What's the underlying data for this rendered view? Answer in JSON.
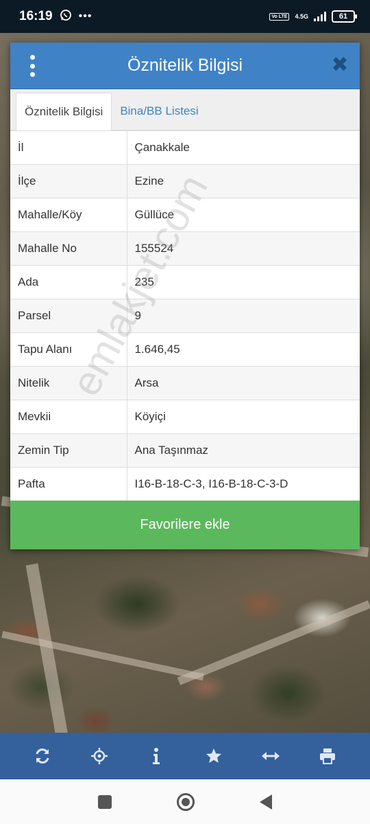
{
  "status_bar": {
    "time": "16:19",
    "network": "4.5G",
    "volte": "Vo LTE",
    "battery": "61"
  },
  "dialog": {
    "title": "Öznitelik Bilgisi",
    "close_symbol": "✖",
    "tabs": [
      {
        "label": "Öznitelik Bilgisi",
        "active": true
      },
      {
        "label": "Bina/BB Listesi",
        "active": false
      }
    ],
    "rows": [
      {
        "key": "İl",
        "value": "Çanakkale"
      },
      {
        "key": "İlçe",
        "value": "Ezine"
      },
      {
        "key": "Mahalle/Köy",
        "value": "Güllüce"
      },
      {
        "key": "Mahalle No",
        "value": "155524"
      },
      {
        "key": "Ada",
        "value": "235"
      },
      {
        "key": "Parsel",
        "value": "9"
      },
      {
        "key": "Tapu Alanı",
        "value": "1.646,45"
      },
      {
        "key": "Nitelik",
        "value": "Arsa"
      },
      {
        "key": "Mevkii",
        "value": "Köyiçi"
      },
      {
        "key": "Zemin Tip",
        "value": "Ana Taşınmaz"
      },
      {
        "key": "Pafta",
        "value": "I16-B-18-C-3, I16-B-18-C-3-D"
      }
    ],
    "favorite_button": "Favorilere ekle"
  },
  "watermark": "emlakjet.com",
  "toolbar": {
    "icons": [
      "refresh-icon",
      "locate-icon",
      "info-icon",
      "star-icon",
      "measure-icon",
      "print-icon"
    ]
  },
  "colors": {
    "header": "#3f82c6",
    "favorite": "#5cb85c",
    "toolbar": "#34609c"
  }
}
